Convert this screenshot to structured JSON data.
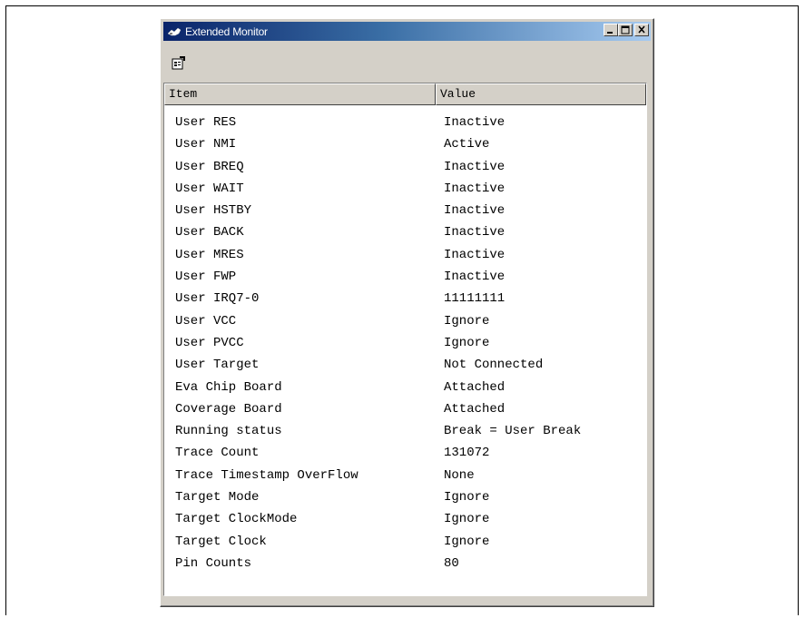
{
  "window": {
    "title": "Extended Monitor",
    "icon": "monitor-app-icon",
    "buttons": [
      "minimize",
      "maximize",
      "close"
    ]
  },
  "toolbar": {
    "properties_icon": "properties-icon"
  },
  "columns": {
    "item": "Item",
    "value": "Value"
  },
  "rows": [
    {
      "item": "User RES",
      "value": "Inactive"
    },
    {
      "item": "User NMI",
      "value": "Active"
    },
    {
      "item": "User BREQ",
      "value": "Inactive"
    },
    {
      "item": "User WAIT",
      "value": "Inactive"
    },
    {
      "item": "User HSTBY",
      "value": "Inactive"
    },
    {
      "item": "User BACK",
      "value": "Inactive"
    },
    {
      "item": "User MRES",
      "value": "Inactive"
    },
    {
      "item": "User FWP",
      "value": "Inactive"
    },
    {
      "item": "User IRQ7-0",
      "value": "11111111"
    },
    {
      "item": "User VCC",
      "value": "Ignore"
    },
    {
      "item": "User PVCC",
      "value": "Ignore"
    },
    {
      "item": "User Target",
      "value": "Not Connected"
    },
    {
      "item": "Eva Chip Board",
      "value": "Attached"
    },
    {
      "item": "Coverage Board",
      "value": "Attached"
    },
    {
      "item": "Running status",
      "value": "Break = User Break"
    },
    {
      "item": "Trace Count",
      "value": "131072"
    },
    {
      "item": "Trace Timestamp OverFlow",
      "value": "None"
    },
    {
      "item": "Target Mode",
      "value": "Ignore"
    },
    {
      "item": "Target ClockMode",
      "value": "Ignore"
    },
    {
      "item": "Target Clock",
      "value": "Ignore"
    },
    {
      "item": "Pin Counts",
      "value": "80"
    }
  ]
}
